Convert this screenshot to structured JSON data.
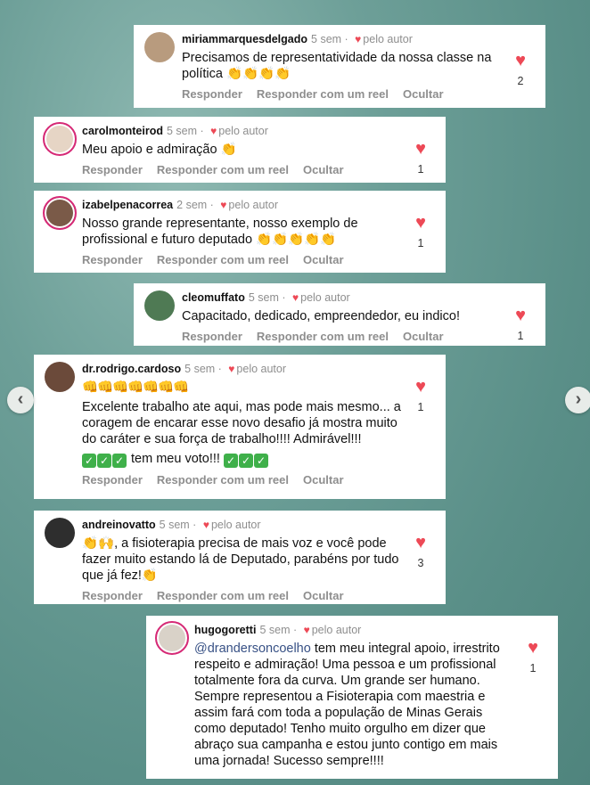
{
  "actions": {
    "reply": "Responder",
    "reply_reel": "Responder com um reel",
    "hide": "Ocultar",
    "by_author": "pelo autor"
  },
  "comments": [
    {
      "user": "miriammarquesdelgado",
      "time": "5 sem",
      "text": "Precisamos de representatividade da nossa classe na política 👏👏👏👏",
      "likes": "2"
    },
    {
      "user": "carolmonteirod",
      "time": "5 sem",
      "text": "Meu apoio e admiração 👏",
      "likes": "1"
    },
    {
      "user": "izabelpenacorrea",
      "time": "2 sem",
      "text": "Nosso grande representante, nosso exemplo de profissional e futuro deputado 👏👏👏👏👏",
      "likes": "1"
    },
    {
      "user": "cleomuffato",
      "time": "5 sem",
      "text": "Capacitado, dedicado, empreendedor, eu indico!",
      "likes": "1"
    },
    {
      "user": "dr.rodrigo.cardoso",
      "time": "5 sem",
      "emojis": "👊👊👊👊👊👊👊",
      "text": "Excelente trabalho ate aqui, mas pode mais mesmo... a coragem de encarar esse novo desafio já mostra muito do caráter e sua força de trabalho!!!! Admirável!!!",
      "vote": "tem meu voto!!!",
      "likes": "1"
    },
    {
      "user": "andreinovatto",
      "time": "5 sem",
      "text": "👏🙌, a fisioterapia precisa de mais voz e você pode fazer muito estando lá de Deputado, parabéns por tudo que já fez!👏",
      "likes": "3"
    },
    {
      "user": "hugogoretti",
      "time": "5 sem",
      "mention": "@drandersoncoelho",
      "text": " tem meu integral apoio, irrestrito respeito e admiração! Uma pessoa e um profissional totalmente fora da curva. Um grande ser humano. Sempre representou a Fisioterapia com maestria e assim fará com toda a população de Minas Gerais como deputado! Tenho muito orgulho em dizer que abraço sua campanha e estou junto contigo em mais uma jornada! Sucesso sempre!!!!",
      "likes": "1"
    }
  ],
  "nav": {
    "prev_icon": "chevron-left-icon",
    "next_icon": "chevron-right-icon"
  }
}
